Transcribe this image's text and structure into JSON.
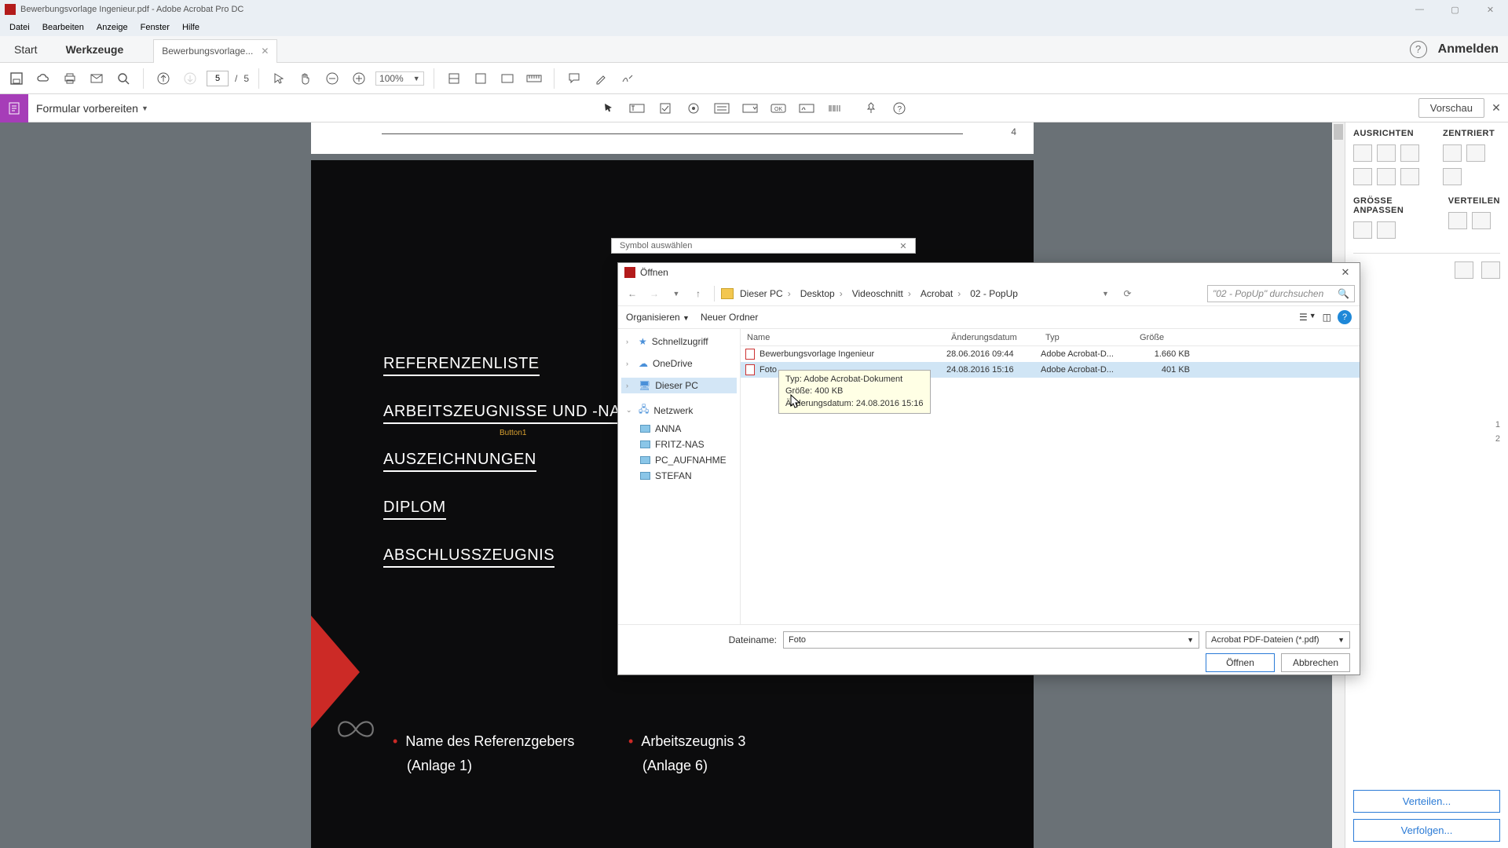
{
  "titlebar": {
    "text": "Bewerbungsvorlage Ingenieur.pdf - Adobe Acrobat Pro DC"
  },
  "menu": {
    "items": [
      "Datei",
      "Bearbeiten",
      "Anzeige",
      "Fenster",
      "Hilfe"
    ]
  },
  "tabs": {
    "start": "Start",
    "tools": "Werkzeuge",
    "doc": "Bewerbungsvorlage...",
    "login": "Anmelden"
  },
  "toolbar": {
    "page_cur": "5",
    "page_sep": "/",
    "page_total": "5",
    "zoom": "100%"
  },
  "formbar": {
    "label": "Formular vorbereiten",
    "preview": "Vorschau"
  },
  "page": {
    "num": "4"
  },
  "doc": {
    "sections": [
      "REFERENZENLISTE",
      "ARBEITSZEUGNISSE UND -NACHWEISE",
      "AUSZEICHNUNGEN",
      "DIPLOM",
      "ABSCHLUSSZEUGNIS"
    ],
    "field_label": "Button1",
    "bullets_left": [
      "Name des Referenzgebers",
      "(Anlage 1)"
    ],
    "bullets_right": [
      "Arbeitszeugnis 3",
      "(Anlage 6)"
    ]
  },
  "rpanel": {
    "align": "AUSRICHTEN",
    "center": "ZENTRIERT",
    "size": "GRÖSSE ANPASSEN",
    "dist": "VERTEILEN",
    "num1": "1",
    "num2": "2",
    "btn1": "Verteilen...",
    "btn2": "Verfolgen..."
  },
  "symdlg": {
    "title": "Symbol auswählen"
  },
  "open": {
    "title": "Öffnen",
    "crumbs": [
      "Dieser PC",
      "Desktop",
      "Videoschnitt",
      "Acrobat",
      "02 - PopUp"
    ],
    "search_ph": "\"02 - PopUp\" durchsuchen",
    "organize": "Organisieren",
    "newfolder": "Neuer Ordner",
    "tree": {
      "quick": "Schnellzugriff",
      "onedrive": "OneDrive",
      "pc": "Dieser PC",
      "net": "Netzwerk",
      "netitems": [
        "ANNA",
        "FRITZ-NAS",
        "PC_AUFNAHME",
        "STEFAN"
      ]
    },
    "cols": {
      "name": "Name",
      "date": "Änderungsdatum",
      "type": "Typ",
      "size": "Größe"
    },
    "rows": [
      {
        "name": "Bewerbungsvorlage Ingenieur",
        "date": "28.06.2016 09:44",
        "type": "Adobe Acrobat-D...",
        "size": "1.660 KB"
      },
      {
        "name": "Foto",
        "date": "24.08.2016 15:16",
        "type": "Adobe Acrobat-D...",
        "size": "401 KB"
      }
    ],
    "tooltip": {
      "l1": "Typ: Adobe Acrobat-Dokument",
      "l2": "Größe: 400 KB",
      "l3": "Änderungsdatum: 24.08.2016 15:16"
    },
    "fname_label": "Dateiname:",
    "fname": "Foto",
    "ftype": "Acrobat PDF-Dateien (*.pdf)",
    "open_btn": "Öffnen",
    "cancel_btn": "Abbrechen"
  }
}
